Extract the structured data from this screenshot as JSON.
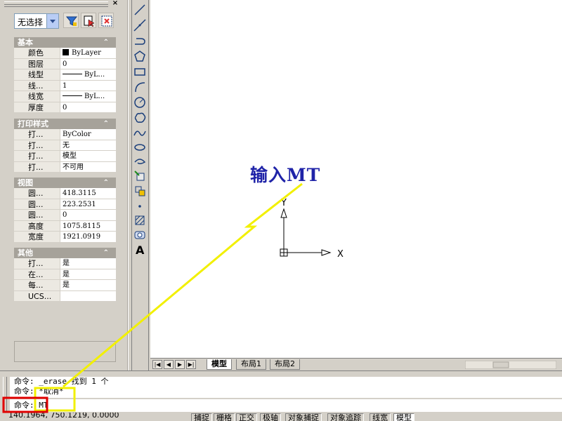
{
  "palette": {
    "selection": "无选择",
    "sections": [
      {
        "title": "基本",
        "rows": [
          {
            "key": "颜色",
            "value": "ByLayer"
          },
          {
            "key": "图层",
            "value": "0"
          },
          {
            "key": "线型",
            "value": "ByL..."
          },
          {
            "key": "线...",
            "value": "1"
          },
          {
            "key": "线宽",
            "value": "ByL..."
          },
          {
            "key": "厚度",
            "value": "0"
          }
        ]
      },
      {
        "title": "打印样式",
        "rows": [
          {
            "key": "打...",
            "value": "ByColor"
          },
          {
            "key": "打...",
            "value": "无"
          },
          {
            "key": "打...",
            "value": "模型"
          },
          {
            "key": "打...",
            "value": "不可用"
          }
        ]
      },
      {
        "title": "视图",
        "rows": [
          {
            "key": "圆...",
            "value": "418.3115"
          },
          {
            "key": "圆...",
            "value": "223.2531"
          },
          {
            "key": "圆...",
            "value": "0"
          },
          {
            "key": "高度",
            "value": "1075.8115"
          },
          {
            "key": "宽度",
            "value": "1921.0919"
          }
        ]
      },
      {
        "title": "其他",
        "rows": [
          {
            "key": "打...",
            "value": "是"
          },
          {
            "key": "在...",
            "value": "是"
          },
          {
            "key": "每...",
            "value": "是"
          },
          {
            "key": "UCS...",
            "value": ""
          }
        ]
      }
    ]
  },
  "drawing": {
    "annotation": "输入MT",
    "ucs_x_label": "X",
    "ucs_y_label": "Y",
    "annotation_color": "#1f23a8",
    "highlight_color": "#f2f000",
    "input_box_color": "#e00000"
  },
  "layout_tabs": [
    "模型",
    "布局1",
    "布局2"
  ],
  "command": {
    "history": [
      "命令:  _erase 找到 1 个",
      "命令:  *取消*"
    ],
    "input": "命令:  MT"
  },
  "status": {
    "coords": "140.1964, 750.1219, 0.0000",
    "buttons": [
      "捕捉",
      "栅格",
      "正交",
      "极轴",
      "对象捕捉",
      "对象追踪",
      "线宽",
      "模型"
    ]
  }
}
